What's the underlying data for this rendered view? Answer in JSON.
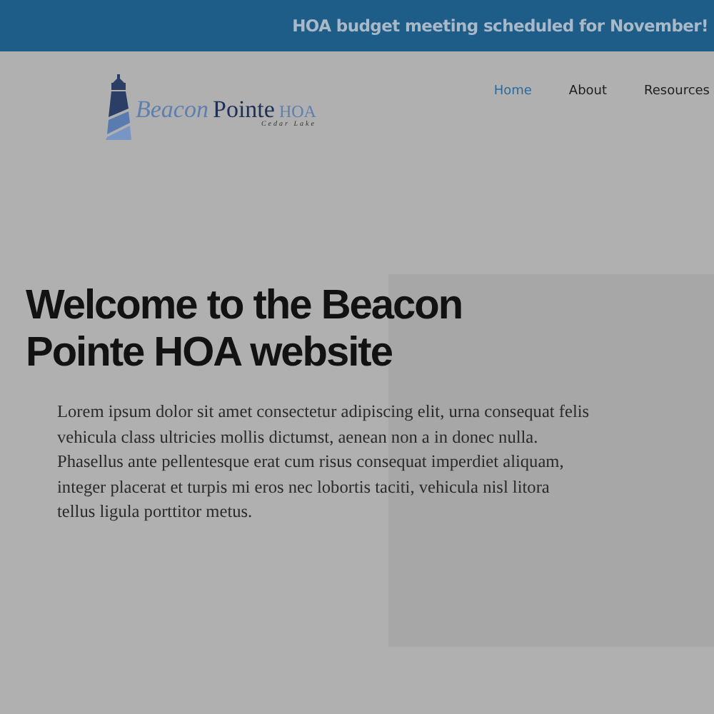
{
  "announcement": "HOA budget meeting scheduled for November!",
  "logo": {
    "word_1": "Beacon",
    "word_2": "Pointe",
    "word_3": "HOA",
    "tagline": "Cedar Lake"
  },
  "nav": [
    {
      "label": "Home",
      "selected": true
    },
    {
      "label": "About",
      "selected": false
    },
    {
      "label": "Resources",
      "selected": false
    }
  ],
  "hero": {
    "heading": "Welcome to the Beacon Pointe HOA website",
    "body": "Lorem ipsum dolor sit amet consectetur adipiscing elit, urna consequat felis vehicula class ultricies mollis dictumst, aenean non a in donec nulla. Phasellus ante pellentesque erat cum risus consequat imperdiet aliquam, integer placerat et turpis mi eros nec lobortis taciti, vehicula nisl litora tellus ligula porttitor metus."
  }
}
